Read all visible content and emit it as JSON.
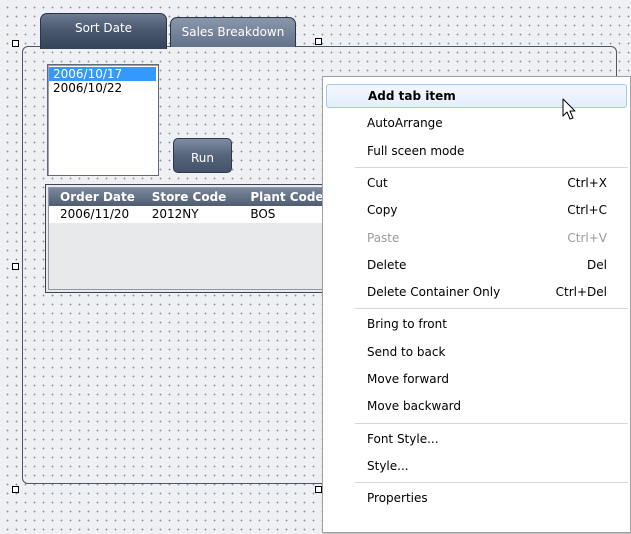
{
  "tabs": [
    {
      "label": "Sort Date",
      "active": true
    },
    {
      "label": "Sales Breakdown",
      "active": false
    }
  ],
  "listbox": {
    "items": [
      "2006/10/17",
      "2006/10/22"
    ],
    "selected_index": 0
  },
  "run_button": {
    "label": "Run"
  },
  "grid": {
    "columns": [
      "Order Date",
      "Store Code",
      "Plant Code"
    ],
    "rows": [
      [
        "2006/11/20",
        "2012NY",
        "BOS"
      ]
    ]
  },
  "context_menu": {
    "groups": [
      [
        {
          "label": "Add tab item",
          "shortcut": "",
          "highlighted": true,
          "disabled": false
        },
        {
          "label": "AutoArrange",
          "shortcut": "",
          "highlighted": false,
          "disabled": false
        },
        {
          "label": "Full sceen mode",
          "shortcut": "",
          "highlighted": false,
          "disabled": false
        }
      ],
      [
        {
          "label": "Cut",
          "shortcut": "Ctrl+X",
          "highlighted": false,
          "disabled": false
        },
        {
          "label": "Copy",
          "shortcut": "Ctrl+C",
          "highlighted": false,
          "disabled": false
        },
        {
          "label": "Paste",
          "shortcut": "Ctrl+V",
          "highlighted": false,
          "disabled": true
        },
        {
          "label": "Delete",
          "shortcut": "Del",
          "highlighted": false,
          "disabled": false
        },
        {
          "label": "Delete Container Only",
          "shortcut": "Ctrl+Del",
          "highlighted": false,
          "disabled": false
        }
      ],
      [
        {
          "label": "Bring to front",
          "shortcut": "",
          "highlighted": false,
          "disabled": false
        },
        {
          "label": "Send to back",
          "shortcut": "",
          "highlighted": false,
          "disabled": false
        },
        {
          "label": "Move forward",
          "shortcut": "",
          "highlighted": false,
          "disabled": false
        },
        {
          "label": "Move backward",
          "shortcut": "",
          "highlighted": false,
          "disabled": false
        }
      ],
      [
        {
          "label": "Font Style...",
          "shortcut": "",
          "highlighted": false,
          "disabled": false
        },
        {
          "label": "Style...",
          "shortcut": "",
          "highlighted": false,
          "disabled": false
        }
      ],
      [
        {
          "label": "Properties",
          "shortcut": "",
          "highlighted": false,
          "disabled": false
        }
      ]
    ]
  },
  "colors": {
    "tab_active": "#4a5870",
    "selection": "#3399ff",
    "menu_highlight_border": "#a9c6eb",
    "disabled_text": "#9a9a9a"
  },
  "icons": {
    "cursor": "mouse-pointer-icon"
  }
}
